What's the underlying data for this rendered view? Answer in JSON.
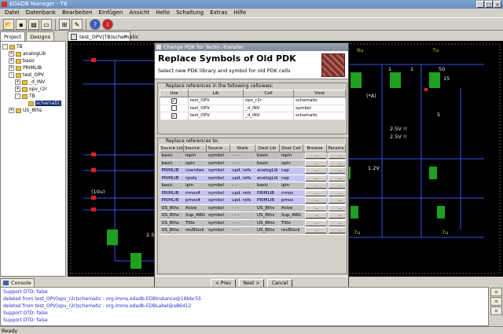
{
  "app": {
    "title": "EDADB Manager - TB",
    "window_buttons": [
      "_",
      "□",
      "×"
    ]
  },
  "menubar": [
    "Datei",
    "Datenbank",
    "Bearbeiten",
    "Einfügen",
    "Ansicht",
    "Hello",
    "Schaltung",
    "Extras",
    "Hilfe"
  ],
  "left_panel": {
    "tabs": [
      "Project",
      "Designs"
    ],
    "tree": [
      {
        "label": "TB",
        "level": 0,
        "toggle": "-"
      },
      {
        "label": "analogLib",
        "level": 1,
        "toggle": "+"
      },
      {
        "label": "basic",
        "level": 1,
        "toggle": "+"
      },
      {
        "label": "PRIMLIB",
        "level": 1,
        "toggle": "+"
      },
      {
        "label": "test_OPV",
        "level": 1,
        "toggle": "-"
      },
      {
        "label": "_d_INV",
        "level": 2,
        "toggle": "+"
      },
      {
        "label": "opv_r2r",
        "level": 2,
        "toggle": "+"
      },
      {
        "label": "TB",
        "level": 2,
        "toggle": "-"
      },
      {
        "label": "schematic",
        "level": 3,
        "toggle": "",
        "selected": true
      },
      {
        "label": "US_8ths",
        "level": 1,
        "toggle": "+"
      }
    ]
  },
  "editor": {
    "tab_label": "test_OPV|TB|schematic",
    "schematic_labels": [
      "9u",
      "7u",
      "40",
      "1",
      "1",
      "50",
      "15",
      "(*A)",
      "5",
      "2.5V !!",
      "2.5V !!",
      "1.2V",
      "(10u)",
      "2.5",
      "7u",
      "7u"
    ]
  },
  "dialog": {
    "title": "Change PDK for Techn.-Transfer",
    "heading": "Replace Symbols of Old PDK",
    "subtitle": "Select new PDK library and symbol for old PDK cells",
    "cellviews": {
      "label": "Replace references in the following cellviews:",
      "columns": [
        "Use",
        "Lib",
        "Cell",
        "View"
      ],
      "rows": [
        {
          "use": true,
          "lib": "test_OPV",
          "cell": "opv_r2r",
          "view": "schematic"
        },
        {
          "use": false,
          "lib": "test_OPV",
          "cell": "_d_INV",
          "view": "symbol"
        },
        {
          "use": true,
          "lib": "test_OPV",
          "cell": "_d_INV",
          "view": "schematic"
        }
      ]
    },
    "references": {
      "label": "Replace references to:",
      "columns": [
        "Source Lib",
        "Source ...",
        "Source ...",
        "State",
        "Dest Lib",
        "Dest Cell",
        "Browse",
        "Params"
      ],
      "button_label": "...",
      "rows": [
        {
          "src_lib": "basic",
          "src_cell": "iopin",
          "src_view": "symbol",
          "state": "- - -",
          "dest_lib": "basic",
          "dest_cell": "iopin",
          "hl": false
        },
        {
          "src_lib": "basic",
          "src_cell": "opin",
          "src_view": "symbol",
          "state": "- - -",
          "dest_lib": "basic",
          "dest_cell": "opin",
          "hl": false
        },
        {
          "src_lib": "PRIMLIB",
          "src_cell": "csandws",
          "src_view": "symbol",
          "state": "upd. refs",
          "dest_lib": "analogLib",
          "dest_cell": "cap",
          "hl": true
        },
        {
          "src_lib": "PRIMLIB",
          "src_cell": "cpoly",
          "src_view": "symbol",
          "state": "upd. refs",
          "dest_lib": "analogLib",
          "dest_cell": "cap",
          "hl": true
        },
        {
          "src_lib": "basic",
          "src_cell": "ipin",
          "src_view": "symbol",
          "state": "- - -",
          "dest_lib": "basic",
          "dest_cell": "ipin",
          "hl": false
        },
        {
          "src_lib": "PRIMLIB",
          "src_cell": "nmos4",
          "src_view": "symbol",
          "state": "upd. refs",
          "dest_lib": "PRIMLIB",
          "dest_cell": "nmos",
          "hl": true
        },
        {
          "src_lib": "PRIMLIB",
          "src_cell": "pmos4",
          "src_view": "symbol",
          "state": "upd. refs",
          "dest_lib": "PRIMLIB",
          "dest_cell": "pmos",
          "hl": true
        },
        {
          "src_lib": "US_8ths",
          "src_cell": "Asize",
          "src_view": "symbol",
          "state": "- - -",
          "dest_lib": "US_8ths",
          "dest_cell": "Asize",
          "hl": false
        },
        {
          "src_lib": "US_8ths",
          "src_cell": "Sup_ABG",
          "src_view": "symbol",
          "state": "- - -",
          "dest_lib": "US_8ths",
          "dest_cell": "Sup_ABG",
          "hl": false
        },
        {
          "src_lib": "US_8ths",
          "src_cell": "Title",
          "src_view": "symbol",
          "state": "- - -",
          "dest_lib": "US_8ths",
          "dest_cell": "Title",
          "hl": false
        },
        {
          "src_lib": "US_8ths",
          "src_cell": "revBlock",
          "src_view": "symbol",
          "state": "- - -",
          "dest_lib": "US_8ths",
          "dest_cell": "revBlock",
          "hl": false
        }
      ]
    },
    "buttons": {
      "prev": "< Prev",
      "next": "Next >",
      "cancel": "Cancel"
    }
  },
  "console": {
    "tab_label": "Console",
    "lines": [
      "Support DTD: false",
      "deleted from test_OPV|opv_r2r|schematic : org.imms.edadb.EDBInstance@16bbc55",
      "deleted from test_OPV|opv_r2r|schematic : org.imms.edadb.EDBLabel@a86d12",
      "Support DTD: false",
      "Support DTD: false"
    ]
  },
  "status": "Ready"
}
